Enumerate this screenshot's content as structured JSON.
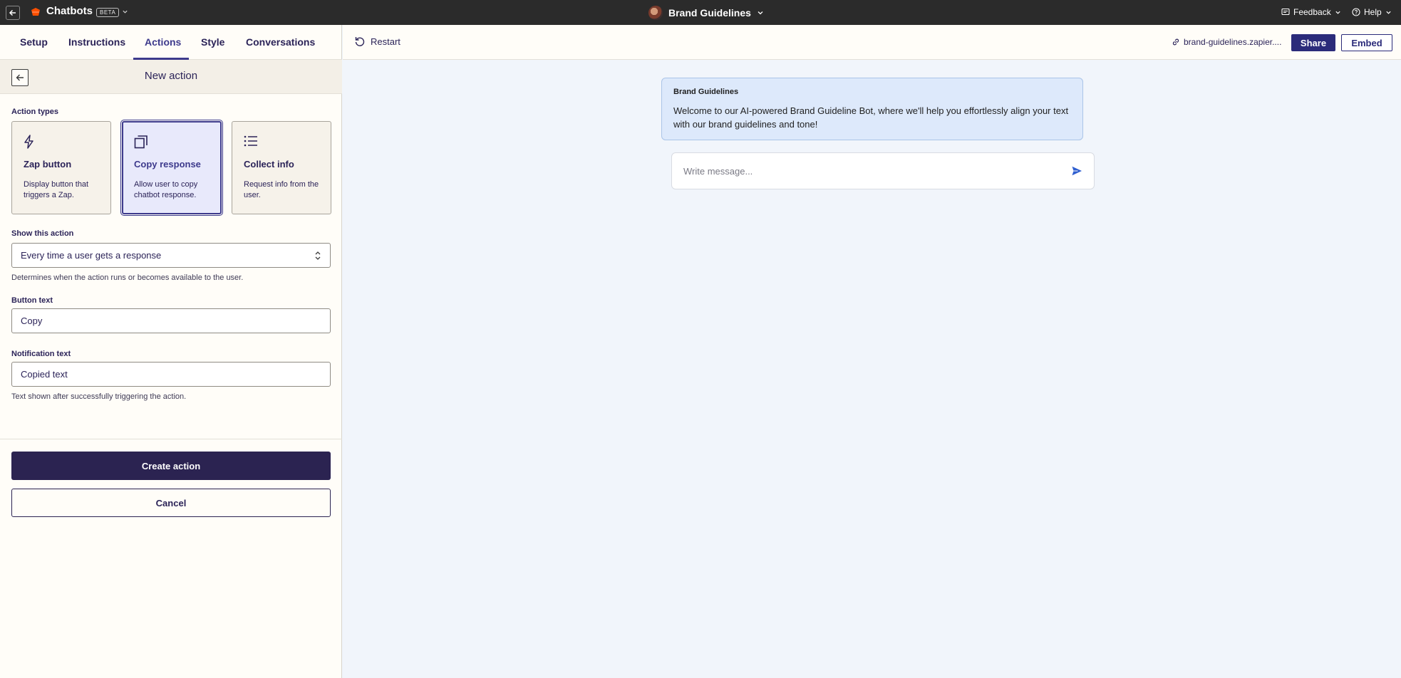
{
  "topbar": {
    "app_title": "Chatbots",
    "beta_badge": "BETA",
    "bot_name": "Brand Guidelines",
    "feedback_label": "Feedback",
    "help_label": "Help"
  },
  "tabs": [
    {
      "label": "Setup"
    },
    {
      "label": "Instructions"
    },
    {
      "label": "Actions",
      "active": true
    },
    {
      "label": "Style"
    },
    {
      "label": "Conversations"
    }
  ],
  "panel": {
    "title": "New action",
    "action_types_label": "Action types",
    "action_types": [
      {
        "title": "Zap button",
        "desc": "Display button that triggers a Zap.",
        "icon": "lightning-icon"
      },
      {
        "title": "Copy response",
        "desc": "Allow user to copy chatbot response.",
        "icon": "copy-icon",
        "selected": true
      },
      {
        "title": "Collect info",
        "desc": "Request info from the user.",
        "icon": "list-icon"
      }
    ],
    "show_action_label": "Show this action",
    "show_action_value": "Every time a user gets a response",
    "show_action_hint": "Determines when the action runs or becomes available to the user.",
    "button_text_label": "Button text",
    "button_text_value": "Copy",
    "notification_label": "Notification text",
    "notification_value": "Copied text",
    "notification_hint": "Text shown after successfully triggering the action.",
    "create_label": "Create action",
    "cancel_label": "Cancel"
  },
  "preview": {
    "restart_label": "Restart",
    "link_text": "brand-guidelines.zapier....",
    "share_label": "Share",
    "embed_label": "Embed",
    "bot_name": "Brand Guidelines",
    "welcome_message": "Welcome to our AI-powered Brand Guideline Bot, where we'll help you effortlessly align your text with our brand guidelines and tone!",
    "message_placeholder": "Write message..."
  },
  "colors": {
    "accent": "#3d3a8c",
    "primary_button": "#2b2351",
    "topbar": "#2b2b2b",
    "logo": "#ff4f00"
  }
}
